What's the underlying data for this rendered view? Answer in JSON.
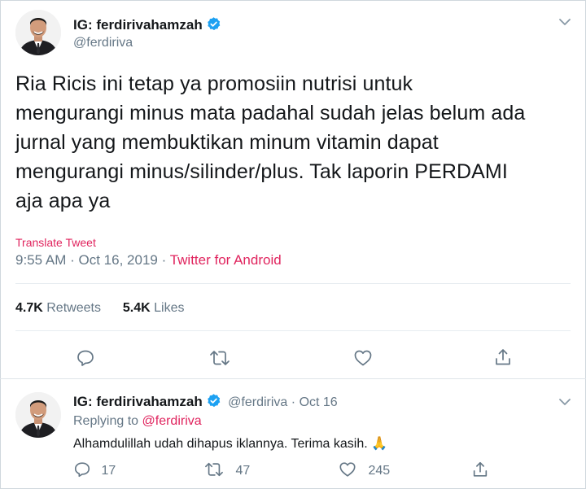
{
  "tweet": {
    "display_name": "IG: ferdirivahamzah",
    "handle": "@ferdiriva",
    "text_lines": [
      "Ria Ricis ini tetap ya promosiin nutrisi untuk",
      "mengurangi minus mata padahal sudah jelas belum ada",
      "jurnal yang membuktikan minum vitamin dapat",
      "mengurangi minus/silinder/plus. Tak laporin PERDAMI",
      "aja apa ya"
    ],
    "translate_label": "Translate Tweet",
    "time": "9:55 AM",
    "date": "Oct 16, 2019",
    "separator": "·",
    "source": "Twitter for Android",
    "retweets_count": "4.7K",
    "retweets_label": "Retweets",
    "likes_count": "5.4K",
    "likes_label": "Likes"
  },
  "reply": {
    "display_name": "IG: ferdirivahamzah",
    "handle": "@ferdiriva",
    "separator": "·",
    "date": "Oct 16",
    "replying_prefix": "Replying to",
    "replying_to": "@ferdiriva",
    "text": "Alhamdulillah udah dihapus iklannya. Terima kasih.",
    "emoji": "🙏",
    "reply_count": "17",
    "retweet_count": "47",
    "like_count": "245"
  },
  "colors": {
    "verified": "#1da1f2",
    "link_pink": "#e0245e",
    "muted": "#657786",
    "text": "#14171a"
  }
}
